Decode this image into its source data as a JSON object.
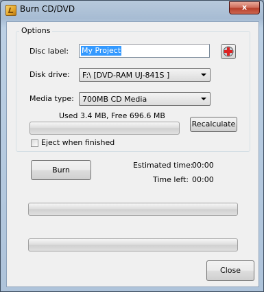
{
  "window": {
    "title": "Burn CD/DVD",
    "close_glyph": "x"
  },
  "options": {
    "group_title": "Options",
    "disc_label": {
      "label": "Disc label:",
      "value": "My Project"
    },
    "disk_drive": {
      "label": "Disk drive:",
      "value": "F:\\ [DVD-RAM UJ-841S ]"
    },
    "media_type": {
      "label": "Media type:",
      "value": "700MB CD Media"
    },
    "usage_text": "Used 3.4 MB, Free 696.6 MB",
    "usage_fraction": 0.0,
    "recalculate_label": "Recalculate",
    "eject": {
      "label": "Eject when finished",
      "checked": false
    }
  },
  "burn": {
    "button_label": "Burn",
    "estimated_time_label": "Estimated time:",
    "estimated_time_value": "00:00",
    "time_left_label": "Time left:",
    "time_left_value": "00:00",
    "progress1_fraction": 0.0,
    "progress2_fraction": 0.0
  },
  "close_label": "Close",
  "icons": {
    "app": "burn-app-icon",
    "label_tool": "disc-label-tool-icon"
  }
}
